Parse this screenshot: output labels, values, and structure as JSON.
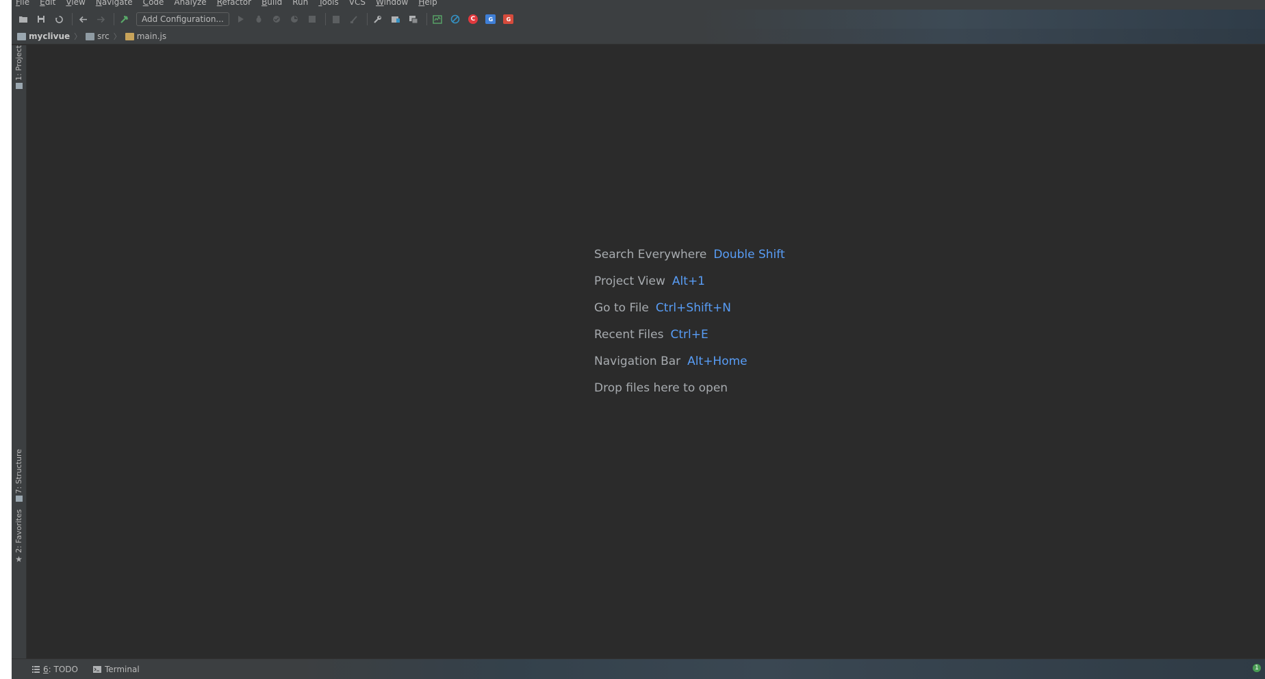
{
  "menubar": {
    "items": [
      {
        "mn": "F",
        "rest": "ile"
      },
      {
        "mn": "E",
        "rest": "dit"
      },
      {
        "mn": "V",
        "rest": "iew"
      },
      {
        "mn": "N",
        "rest": "avigate"
      },
      {
        "mn": "C",
        "rest": "ode"
      },
      {
        "mn": "",
        "rest": "Analyze"
      },
      {
        "mn": "R",
        "rest": "efactor"
      },
      {
        "mn": "B",
        "rest": "uild"
      },
      {
        "mn": "",
        "rest": "Run"
      },
      {
        "mn": "T",
        "rest": "ools"
      },
      {
        "mn": "",
        "rest": "VCS"
      },
      {
        "mn": "W",
        "rest": "indow"
      },
      {
        "mn": "H",
        "rest": "elp"
      }
    ]
  },
  "toolbar": {
    "run_config_label": "Add Configuration..."
  },
  "breadcrumb": {
    "project": "myclivue",
    "folder": "src",
    "file": "main.js"
  },
  "tool_windows": {
    "project": "1: Project",
    "structure": "7: Structure",
    "favorites": "2: Favorites"
  },
  "welcome": {
    "rows": [
      {
        "label": "Search Everywhere",
        "shortcut": "Double Shift"
      },
      {
        "label": "Project View",
        "shortcut": "Alt+1"
      },
      {
        "label": "Go to File",
        "shortcut": "Ctrl+Shift+N"
      },
      {
        "label": "Recent Files",
        "shortcut": "Ctrl+E"
      },
      {
        "label": "Navigation Bar",
        "shortcut": "Alt+Home"
      }
    ],
    "drop_hint": "Drop files here to open"
  },
  "statusbar": {
    "todo_prefix": "6",
    "todo_label": ": TODO",
    "terminal_label": "Terminal",
    "event_count": "1"
  },
  "colors": {
    "editor_bg": "#2b2b2b",
    "chrome_bg": "#3c3f41",
    "shortcut_blue": "#589df6",
    "text_gray": "#a7abaf"
  }
}
